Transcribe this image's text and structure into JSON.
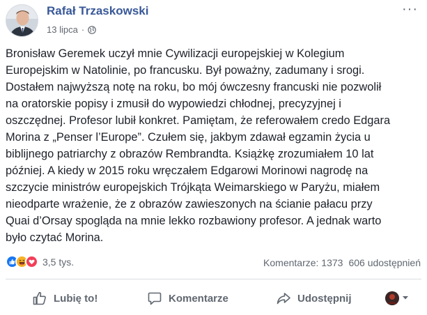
{
  "post": {
    "author": "Rafał Trzaskowski",
    "date": "13 lipca",
    "separator": "·",
    "more_label": "···",
    "text_lines": [
      "Bronisław Geremek uczył mnie Cywilizacji europejskiej w Kolegium",
      "Europejskim w Natolinie, po francusku. Był poważny, zadumany i srogi.",
      "Dostałem najwyższą notę na roku, bo mój ówczesny francuski nie pozwolił",
      "na oratorskie popisy i zmusił do wypowiedzi chłodnej, precyzyjnej i",
      "oszczędnej. Profesor lubił konkret. Pamiętam, że referowałem credo Edgara",
      "Morina z „Penser l’Europe”. Czułem się, jakbym zdawał egzamin życia u",
      "biblijnego patriarchy z obrazów Rembrandta. Książkę zrozumiałem 10 lat",
      "później. A kiedy w 2015 roku wręczałem Edgarowi Morinowi nagrodę na",
      "szczycie ministrów europejskich Trójkąta Weimarskiego w Paryżu, miałem",
      "nieodparte wrażenie, że z obrazów zawieszonych na ścianie pałacu przy",
      "Quai d’Orsay spogląda na mnie lekko rozbawiony profesor. A jednak warto",
      "było czytać Morina."
    ]
  },
  "reactions": {
    "count": "3,5 tys.",
    "icons": [
      "like-icon",
      "haha-icon",
      "love-icon"
    ],
    "colors": {
      "like": "#1877f2",
      "haha": "#f7b125",
      "love": "#f33e58"
    }
  },
  "stats": {
    "comments": "Komentarze: 1373",
    "shares": "606 udostępnień"
  },
  "actions": {
    "like": "Lubię to!",
    "comment": "Komentarze",
    "share": "Udostępnij"
  },
  "theme": {
    "link": "#385898",
    "muted": "#606770",
    "text": "#1d2129"
  }
}
